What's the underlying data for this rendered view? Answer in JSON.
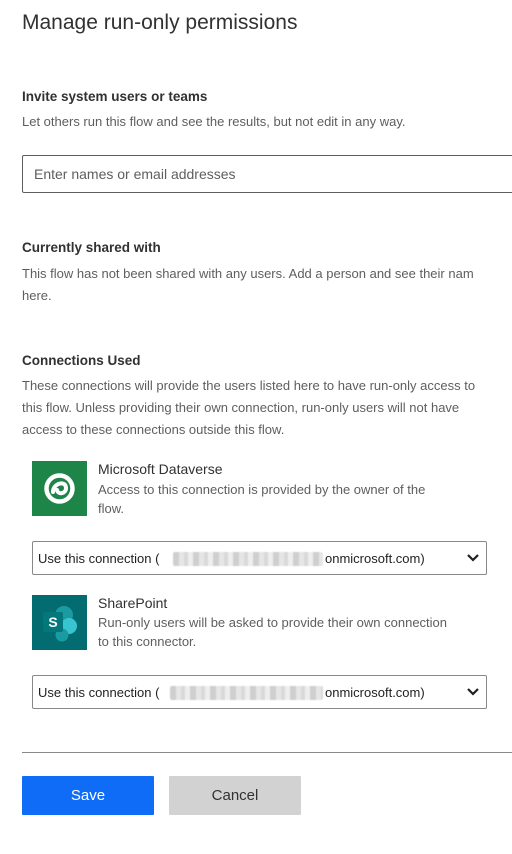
{
  "dialog": {
    "title": "Manage run-only permissions"
  },
  "invite": {
    "heading": "Invite system users or teams",
    "description": "Let others run this flow and see the results, but not edit in any way.",
    "input_placeholder": "Enter names or email addresses",
    "input_value": ""
  },
  "shared": {
    "heading": "Currently shared with",
    "description_line1": "This flow has not been shared with any users. Add a person and see their nam",
    "description_line2": "here."
  },
  "connections": {
    "heading": "Connections Used",
    "description_line1": "These connections will provide the users listed here to have run-only access to",
    "description_line2": "this flow. Unless providing their own connection, run-only users will not have",
    "description_line3": "access to these connections outside this flow.",
    "items": [
      {
        "name": "Microsoft Dataverse",
        "icon": "dataverse-icon",
        "icon_color": "#1d8547",
        "note_line1": "Access to this connection is provided by the owner of the",
        "note_line2": "flow.",
        "select_prefix": "Use this connection (",
        "select_suffix": "onmicrosoft.com)"
      },
      {
        "name": "SharePoint",
        "icon": "sharepoint-icon",
        "icon_color": "#036c70",
        "note_line1": "Run-only users will be asked to provide their own connection",
        "note_line2": "to this connector.",
        "select_prefix": "Use this connection (",
        "select_suffix": "onmicrosoft.com)"
      }
    ]
  },
  "footer": {
    "save_label": "Save",
    "cancel_label": "Cancel"
  },
  "colors": {
    "primary": "#0f6cf6",
    "secondary_button": "#d2d2d2"
  }
}
